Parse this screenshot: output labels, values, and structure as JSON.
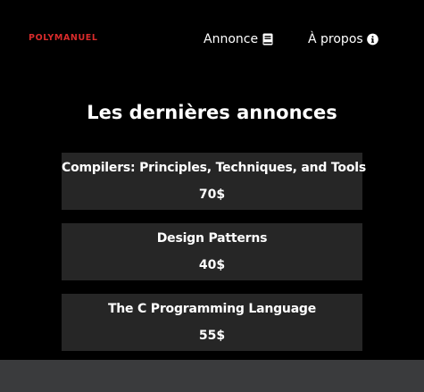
{
  "brand": {
    "name": "POLYMANUEL",
    "color": "#d92b2b"
  },
  "nav": {
    "annonce_label": "Annonce",
    "annonce_icon": "book-icon",
    "apropos_label": "À propos",
    "apropos_icon": "info-circle-icon"
  },
  "main": {
    "heading": "Les dernières annonces",
    "listings": [
      {
        "title": "Compilers: Principles, Techniques, and Tools",
        "price": "70$"
      },
      {
        "title": "Design Patterns",
        "price": "40$"
      },
      {
        "title": "The C Programming Language",
        "price": "55$"
      }
    ]
  },
  "colors": {
    "background": "#000000",
    "card": "#262626",
    "footer": "#3a3b3d"
  }
}
